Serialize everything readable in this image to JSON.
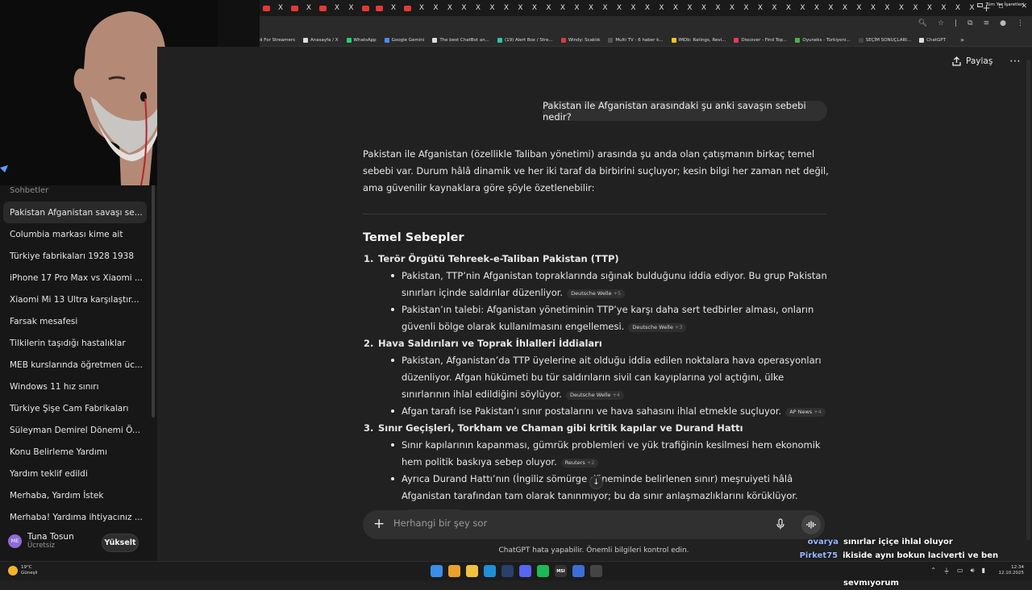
{
  "browser": {
    "tab_count_youtube_pattern": "mixed",
    "tabs": [
      "yt",
      "x",
      "yt",
      "x",
      "yt",
      "x",
      "x",
      "yt",
      "yt",
      "x",
      "yt",
      "x",
      "x",
      "x",
      "x",
      "x",
      "x",
      "x",
      "x",
      "x",
      "x",
      "x",
      "x",
      "x",
      "x",
      "x",
      "x",
      "x",
      "x",
      "x",
      "x",
      "x",
      "x",
      "x",
      "x",
      "x",
      "x",
      "x",
      "x",
      "x",
      "x",
      "x",
      "x",
      "x",
      "x",
      "x",
      "x",
      "x",
      "x",
      "x",
      "x"
    ],
    "new_tab_label": "+",
    "bookmarks": [
      {
        "label": "d For Streamers",
        "color": ""
      },
      {
        "label": "Anasayfa / X",
        "color": "#dddddd"
      },
      {
        "label": "WhatsApp",
        "color": "#25d366"
      },
      {
        "label": "Google Gemini",
        "color": "#4f8bf5"
      },
      {
        "label": "The best ChatBot an...",
        "color": "#dddddd"
      },
      {
        "label": "(19) Alert Box / Stre...",
        "color": "#31c3a2"
      },
      {
        "label": "Windy: Scaklık",
        "color": "#d63b3b"
      },
      {
        "label": "Multi TV - 6 haber k...",
        "color": "#555555"
      },
      {
        "label": "IMDb: Ratings, Revi...",
        "color": "#f5c518"
      },
      {
        "label": "Discover - Find Top...",
        "color": "#e23c5b"
      },
      {
        "label": "Oyuneks - Türkiyeni...",
        "color": "#4caf50"
      },
      {
        "label": "SEÇİM SONUÇLARI...",
        "color": "#444444"
      },
      {
        "label": "ChatGPT",
        "color": "#dddddd"
      }
    ],
    "bookmarks_more": "»",
    "all_bookmarks": "Tüm Yer İşaretleri"
  },
  "sidebar": {
    "section_label": "Sohbetler",
    "chats": [
      {
        "label": "Pakistan Afganistan savaşı se...",
        "active": true
      },
      {
        "label": "Columbia markası kime ait"
      },
      {
        "label": "Türkiye fabrikaları 1928 1938"
      },
      {
        "label": "iPhone 17 Pro Max vs Xiaomi ..."
      },
      {
        "label": "Xiaomi Mi 13 Ultra karşılaştır..."
      },
      {
        "label": "Farsak mesafesi"
      },
      {
        "label": "Tilkilerin taşıdığı hastalıklar"
      },
      {
        "label": "MEB kurslarında öğretmen üc..."
      },
      {
        "label": "Windows 11 hız sınırı"
      },
      {
        "label": "Türkiye Şişe Cam Fabrikaları"
      },
      {
        "label": "Süleyman Demirel Dönemi Ö..."
      },
      {
        "label": "Konu Belirleme Yardımı"
      },
      {
        "label": "Yardım teklif edildi"
      },
      {
        "label": "Merhaba, Yardım İstek"
      },
      {
        "label": "Merhaba! Yardıma ihtiyacınız ..."
      }
    ],
    "user": {
      "initials": "ME",
      "name": "Tuna Tosun",
      "plan": "Ücretsiz"
    },
    "upgrade_label": "Yükselt"
  },
  "header": {
    "share_label": "Paylaş",
    "more_label": "⋯"
  },
  "conversation": {
    "user_message": "Pakistan ile Afganistan arasındaki şu anki savaşın sebebi nedir?",
    "intro": "Pakistan ile Afganistan (özellikle Taliban yönetimi) arasında şu anda olan çatışmanın birkaç temel sebebi var. Durum hâlâ dinamik ve her iki taraf da birbirini suçluyor; kesin bilgi her zaman net değil, ama güvenilir kaynaklara göre şöyle özetlenebilir:",
    "section_title": "Temel Sebepler",
    "items": [
      {
        "num": "1.",
        "title": "Terör Örgütü Tehreek-e-Taliban Pakistan (TTP)",
        "bullets": [
          {
            "text": "Pakistan, TTP’nin Afganistan topraklarında sığınak bulduğunu iddia ediyor. Bu grup Pakistan sınırları içinde saldırılar düzenliyor.",
            "cite": "Deutsche Welle",
            "cite_extra": "+5"
          },
          {
            "text": "Pakistan’ın talebi: Afganistan yönetiminin TTP’ye karşı daha sert tedbirler alması, onların güvenli bölge olarak kullanılmasını engellemesi.",
            "cite": "Deutsche Welle",
            "cite_extra": "+3"
          }
        ]
      },
      {
        "num": "2.",
        "title": "Hava Saldırıları ve Toprak İhlalleri İddiaları",
        "bullets": [
          {
            "text": "Pakistan, Afganistan’da TTP üyelerine ait olduğu iddia edilen noktalara hava operasyonları düzenliyor. Afgan hükümeti bu tür saldırıların sivil can kayıplarına yol açtığını, ülke sınırlarının ihlal edildiğini söylüyor.",
            "cite": "Deutsche Welle",
            "cite_extra": "+4"
          },
          {
            "text": "Afgan tarafı ise Pakistan’ı sınır postalarını ve hava sahasını ihlal etmekle suçluyor.",
            "cite": "AP News",
            "cite_extra": "+4"
          }
        ]
      },
      {
        "num": "3.",
        "title": "Sınır Geçişleri, Torkham ve Chaman gibi kritik kapılar ve Durand Hattı",
        "bullets": [
          {
            "text": "Sınır kapılarının kapanması, gümrük problemleri ve yük trafiğinin kesilmesi hem ekonomik hem politik baskıya sebep oluyor.",
            "cite": "Reuters",
            "cite_extra": "+2"
          },
          {
            "text": "Ayrıca Durand Hattı’nın (İngiliz sömürge döneminde belirlenen sınır) meşruiyeti hâlâ Afganistan tarafından tam olarak tanınmıyor; bu da sınır anlaşmazlıklarını körüklüyor.",
            "cite": "Deutsche Welle",
            "cite_extra": "+2"
          }
        ]
      }
    ]
  },
  "composer": {
    "placeholder": "Herhangi bir şey sor",
    "plus_label": "+"
  },
  "disclaimer": "ChatGPT hata yapabilir. Önemli bilgileri kontrol edin.",
  "stream_chat": [
    {
      "user": "ovarya",
      "msg": "sınırlar içiçe ihlal oluyor"
    },
    {
      "user": "Pirket75",
      "msg": "ikiside aynı bokun laciverti ve ben lacivert"
    },
    {
      "user": "",
      "msg": "sevmiyorum"
    }
  ],
  "taskbar": {
    "weather_temp": "19°C",
    "weather_desc": "Güneşli",
    "time": "12:34",
    "date": "12.10.2025",
    "apps": [
      {
        "name": "start-icon",
        "color": "#3b8eea",
        "label": ""
      },
      {
        "name": "chrome-icon",
        "color": "#e8a12c",
        "label": ""
      },
      {
        "name": "folder-icon",
        "color": "#f0c040",
        "label": ""
      },
      {
        "name": "edge-icon",
        "color": "#1f8fd6",
        "label": ""
      },
      {
        "name": "steam-icon",
        "color": "#27416b",
        "label": ""
      },
      {
        "name": "discord-icon",
        "color": "#5865f2",
        "label": ""
      },
      {
        "name": "spotify-icon",
        "color": "#1db954",
        "label": ""
      },
      {
        "name": "msi-icon",
        "color": "#333333",
        "label": "MSI"
      },
      {
        "name": "app-icon",
        "color": "#3b6fd6",
        "label": ""
      },
      {
        "name": "obs-icon",
        "color": "#444444",
        "label": ""
      }
    ]
  }
}
